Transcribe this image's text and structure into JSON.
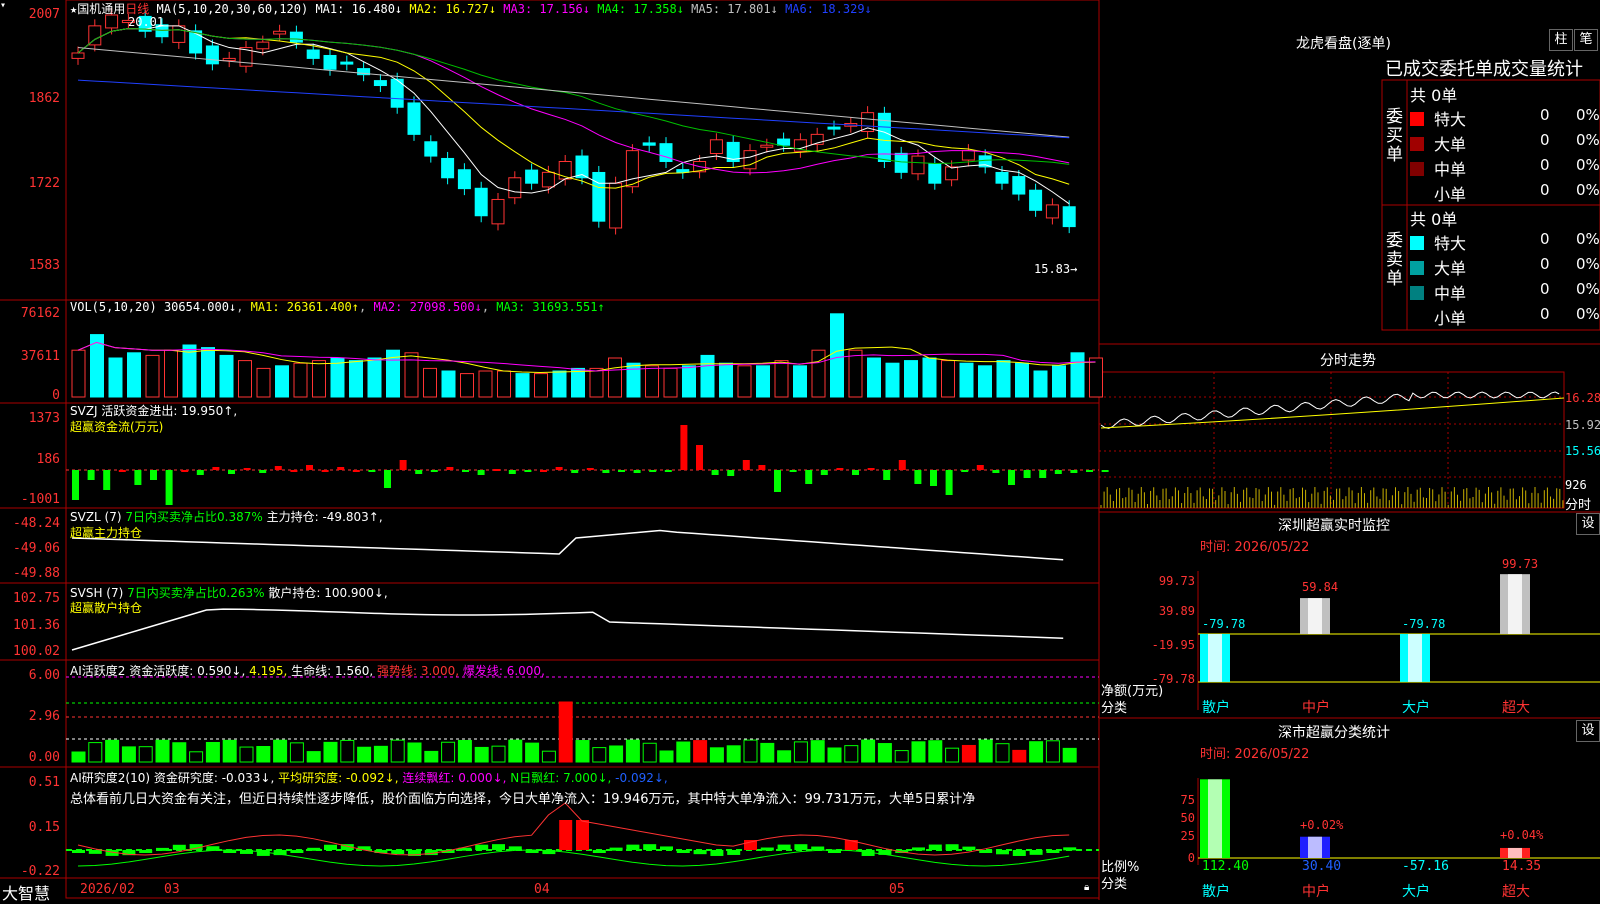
{
  "stock": {
    "title_prefix": "★",
    "name": "国机通用",
    "period": "日线",
    "ma_label": "MA(5,10,20,30,60,120)",
    "ma": [
      {
        "name": "MA1:",
        "value": "16.480",
        "arrow": "↓",
        "color": "#ffffff"
      },
      {
        "name": "MA2:",
        "value": "16.727",
        "arrow": "↓",
        "color": "#ffff00"
      },
      {
        "name": "MA3:",
        "value": "17.156",
        "arrow": "↓",
        "color": "#ff00ff"
      },
      {
        "name": "MA4:",
        "value": "17.358",
        "arrow": "↓",
        "color": "#00ff00"
      },
      {
        "name": "MA5:",
        "value": "17.801",
        "arrow": "↓",
        "color": "#c0c0c0"
      },
      {
        "name": "MA6:",
        "value": "18.329",
        "arrow": "↓",
        "color": "#2040ff"
      }
    ],
    "high_label": "20.01",
    "low_label": "15.83→",
    "y_labels": [
      "2007",
      "1862",
      "1722",
      "1583"
    ]
  },
  "vol": {
    "label": "VOL(5,10,20)",
    "value": "30654.000↓",
    "ma1": "MA1: 26361.400↑",
    "ma2": "MA2: 27098.500↓",
    "ma3": "MA3: 31693.551↑",
    "y_labels": [
      "76162",
      "37611",
      "0"
    ],
    "values": [
      36,
      48,
      30,
      34,
      32,
      36,
      40,
      38,
      32,
      28,
      22,
      24,
      26,
      28,
      30,
      28,
      30,
      36,
      34,
      22,
      20,
      18,
      20,
      20,
      18,
      18,
      20,
      22,
      22,
      30,
      26,
      24,
      22,
      24,
      32,
      26,
      24,
      24,
      28,
      24,
      36,
      64,
      36,
      30,
      26,
      28,
      30,
      28,
      26,
      24,
      28,
      26,
      20,
      24,
      34,
      30
    ],
    "up": [
      0,
      1,
      1,
      1,
      0,
      0,
      1,
      1,
      1,
      0,
      0,
      1,
      0,
      0,
      1,
      1,
      1,
      1,
      0,
      0,
      1,
      0,
      0,
      0,
      1,
      0,
      1,
      1,
      0,
      0,
      1,
      0,
      0,
      1,
      1,
      1,
      0,
      1,
      0,
      1,
      0,
      1,
      0,
      1,
      1,
      1,
      1,
      0,
      1,
      1,
      1,
      1,
      1,
      1,
      1,
      0
    ]
  },
  "svzj": {
    "label": "SVZJ",
    "desc": "活跃资金进出: 19.950↑,",
    "sub": "超赢资金流(万元)",
    "y_labels": [
      "1373",
      "186",
      "-1001"
    ]
  },
  "svzl": {
    "label": "SVZL (7)",
    "desc1": "7日内买卖净占比0.387%",
    "desc2": "主力持仓: -49.803↑,",
    "sub": "超赢主力持仓",
    "y_labels": [
      "-48.24",
      "-49.06",
      "-49.88"
    ]
  },
  "svsh": {
    "label": "SVSH (7)",
    "desc1": "7日内买卖净占比0.263%",
    "desc2": "散户持仓: 100.900↓,",
    "sub": "超赢散户持仓",
    "y_labels": [
      "102.75",
      "101.36",
      "100.02"
    ]
  },
  "ai_active": {
    "label": "AI活跃度2",
    "t1": "资金活跃度: 0.590↓,",
    "t2": "4.195,",
    "t3": "生命线: 1.560,",
    "t4": "强势线: 3.000,",
    "t5": "爆发线: 6.000,",
    "y_labels": [
      "6.00",
      "2.96",
      "0.00"
    ]
  },
  "ai_research": {
    "label": "AI研究度2(10)",
    "t1": "资金研究度: -0.033↓,",
    "t2": "平均研究度: -0.092↓,",
    "t3": "连续飘红: 0.000↓,",
    "t4": "N日飘红: 7.000↓,",
    "t5": "-0.092↓,",
    "summary": "总体看前几日大资金有关注，但近日持续性逐步降低，股价面临方向选择，今日大单净流入：19.946万元，其中特大单净流入：99.731万元，大单5日累计净",
    "y_labels": [
      "0.51",
      "0.15",
      "-0.22"
    ]
  },
  "bottom": {
    "logo": "大智慧",
    "dates": [
      "2026/02",
      "03",
      "04",
      "05"
    ]
  },
  "right": {
    "dragon_title": "龙虎看盘(逐单)",
    "btn1": "柱",
    "btn2": "笔",
    "stats_title": "已成交委托单成交量统计",
    "buy_label": "委买单",
    "sell_label": "委卖单",
    "buy_total": "共 0单",
    "sell_total": "共 0单",
    "rows": [
      {
        "name": "特大",
        "val": "0",
        "pct": "0%"
      },
      {
        "name": "大单",
        "val": "0",
        "pct": "0%"
      },
      {
        "name": "中单",
        "val": "0",
        "pct": "0%"
      },
      {
        "name": "小单",
        "val": "0",
        "pct": "0%"
      }
    ],
    "buy_colors": [
      "#ff0000",
      "#a00000",
      "#800000",
      "#000000"
    ],
    "sell_colors": [
      "#00ffff",
      "#00a0a0",
      "#008080",
      "#000000"
    ],
    "intraday_title": "分时走势",
    "intraday_prices": [
      "16.28",
      "15.92",
      "15.56"
    ],
    "intraday_vol": "926",
    "intraday_unit": "分时",
    "sz_monitor_title": "深圳超赢实时监控",
    "settings": "设",
    "time_label": "时间: 2026/05/22",
    "monitor_y": [
      "99.73",
      "39.89",
      "-19.95",
      "-79.78"
    ],
    "monitor_bars": [
      {
        "cat": "散户",
        "val": "-79.78"
      },
      {
        "cat": "中户",
        "val": "59.84"
      },
      {
        "cat": "大户",
        "val": "-79.78"
      },
      {
        "cat": "超大",
        "val": "99.73"
      }
    ],
    "monitor_axis_label1": "净额(万元)",
    "monitor_axis_label2": "分类",
    "sz_class_title": "深市超赢分类统计",
    "class_y": [
      "75",
      "50",
      "25",
      "0"
    ],
    "class_bars": [
      {
        "cat": "散户",
        "val": "112.40",
        "pct": ""
      },
      {
        "cat": "中户",
        "val": "30.40",
        "pct": "+0.02%"
      },
      {
        "cat": "大户",
        "val": "-57.16",
        "pct": ""
      },
      {
        "cat": "超大",
        "val": "14.35",
        "pct": "+0.04%"
      }
    ],
    "class_axis_label1": "比例%",
    "class_axis_label2": "分类"
  }
}
